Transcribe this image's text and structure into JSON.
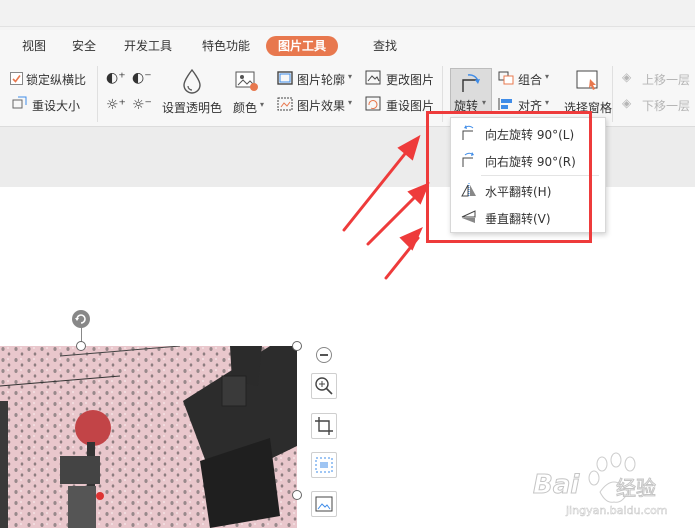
{
  "tabs": [
    {
      "label": "视图"
    },
    {
      "label": "安全"
    },
    {
      "label": "开发工具"
    },
    {
      "label": "特色功能"
    },
    {
      "label": "图片工具"
    },
    {
      "label": "查找"
    }
  ],
  "ribbon": {
    "lock_ratio": "锁定纵横比",
    "reset_size": "重设大小",
    "set_transparent": "设置透明色",
    "color": "颜色",
    "outline": "图片轮廓",
    "effect": "图片效果",
    "change_pic": "更改图片",
    "reset_pic": "重设图片",
    "rotate": "旋转",
    "group": "组合",
    "align": "对齐",
    "select_pane": "选择窗格",
    "bring_forward": "上移一层",
    "send_backward": "下移一层"
  },
  "rotate_menu": {
    "items": [
      {
        "label": "向左旋转 90°(L)"
      },
      {
        "label": "向右旋转 90°(R)"
      },
      {
        "label": "水平翻转(H)"
      },
      {
        "label": "垂直翻转(V)"
      }
    ]
  },
  "watermark": {
    "brand": "Bai",
    "brand2": "经验",
    "url": "jingyan.baidu.com"
  },
  "colors": {
    "accent": "#e8784e",
    "highlight": "#ee3b3b"
  }
}
